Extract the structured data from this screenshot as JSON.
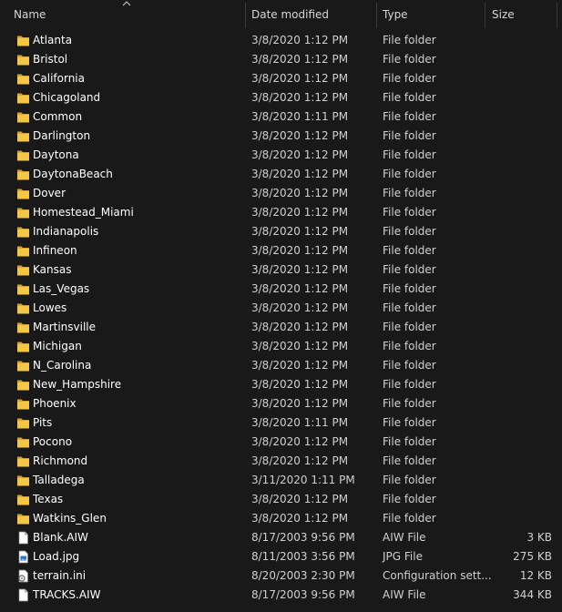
{
  "columns": {
    "name": "Name",
    "date": "Date modified",
    "type": "Type",
    "size": "Size"
  },
  "colors": {
    "background": "#191919",
    "folder": "#f3c645",
    "folder_dark": "#d8a52a",
    "separator": "#3a3a3a"
  },
  "files": [
    {
      "name": "Atlanta",
      "date": "3/8/2020 1:12 PM",
      "type": "File folder",
      "size": "",
      "icon": "folder-icon"
    },
    {
      "name": "Bristol",
      "date": "3/8/2020 1:12 PM",
      "type": "File folder",
      "size": "",
      "icon": "folder-icon"
    },
    {
      "name": "California",
      "date": "3/8/2020 1:12 PM",
      "type": "File folder",
      "size": "",
      "icon": "folder-icon"
    },
    {
      "name": "Chicagoland",
      "date": "3/8/2020 1:12 PM",
      "type": "File folder",
      "size": "",
      "icon": "folder-icon"
    },
    {
      "name": "Common",
      "date": "3/8/2020 1:11 PM",
      "type": "File folder",
      "size": "",
      "icon": "folder-icon"
    },
    {
      "name": "Darlington",
      "date": "3/8/2020 1:12 PM",
      "type": "File folder",
      "size": "",
      "icon": "folder-icon"
    },
    {
      "name": "Daytona",
      "date": "3/8/2020 1:12 PM",
      "type": "File folder",
      "size": "",
      "icon": "folder-icon"
    },
    {
      "name": "DaytonaBeach",
      "date": "3/8/2020 1:12 PM",
      "type": "File folder",
      "size": "",
      "icon": "folder-icon"
    },
    {
      "name": "Dover",
      "date": "3/8/2020 1:12 PM",
      "type": "File folder",
      "size": "",
      "icon": "folder-icon"
    },
    {
      "name": "Homestead_Miami",
      "date": "3/8/2020 1:12 PM",
      "type": "File folder",
      "size": "",
      "icon": "folder-icon"
    },
    {
      "name": "Indianapolis",
      "date": "3/8/2020 1:12 PM",
      "type": "File folder",
      "size": "",
      "icon": "folder-icon"
    },
    {
      "name": "Infineon",
      "date": "3/8/2020 1:12 PM",
      "type": "File folder",
      "size": "",
      "icon": "folder-icon"
    },
    {
      "name": "Kansas",
      "date": "3/8/2020 1:12 PM",
      "type": "File folder",
      "size": "",
      "icon": "folder-icon"
    },
    {
      "name": "Las_Vegas",
      "date": "3/8/2020 1:12 PM",
      "type": "File folder",
      "size": "",
      "icon": "folder-icon"
    },
    {
      "name": "Lowes",
      "date": "3/8/2020 1:12 PM",
      "type": "File folder",
      "size": "",
      "icon": "folder-icon"
    },
    {
      "name": "Martinsville",
      "date": "3/8/2020 1:12 PM",
      "type": "File folder",
      "size": "",
      "icon": "folder-icon"
    },
    {
      "name": "Michigan",
      "date": "3/8/2020 1:12 PM",
      "type": "File folder",
      "size": "",
      "icon": "folder-icon"
    },
    {
      "name": "N_Carolina",
      "date": "3/8/2020 1:12 PM",
      "type": "File folder",
      "size": "",
      "icon": "folder-icon"
    },
    {
      "name": "New_Hampshire",
      "date": "3/8/2020 1:12 PM",
      "type": "File folder",
      "size": "",
      "icon": "folder-icon"
    },
    {
      "name": "Phoenix",
      "date": "3/8/2020 1:12 PM",
      "type": "File folder",
      "size": "",
      "icon": "folder-icon"
    },
    {
      "name": "Pits",
      "date": "3/8/2020 1:11 PM",
      "type": "File folder",
      "size": "",
      "icon": "folder-icon"
    },
    {
      "name": "Pocono",
      "date": "3/8/2020 1:12 PM",
      "type": "File folder",
      "size": "",
      "icon": "folder-icon"
    },
    {
      "name": "Richmond",
      "date": "3/8/2020 1:12 PM",
      "type": "File folder",
      "size": "",
      "icon": "folder-icon"
    },
    {
      "name": "Talladega",
      "date": "3/11/2020 1:11 PM",
      "type": "File folder",
      "size": "",
      "icon": "folder-icon"
    },
    {
      "name": "Texas",
      "date": "3/8/2020 1:12 PM",
      "type": "File folder",
      "size": "",
      "icon": "folder-icon"
    },
    {
      "name": "Watkins_Glen",
      "date": "3/8/2020 1:12 PM",
      "type": "File folder",
      "size": "",
      "icon": "folder-icon"
    },
    {
      "name": "Blank.AIW",
      "date": "8/17/2003 9:56 PM",
      "type": "AIW File",
      "size": "3 KB",
      "icon": "file-icon"
    },
    {
      "name": "Load.jpg",
      "date": "8/11/2003 3:56 PM",
      "type": "JPG File",
      "size": "275 KB",
      "icon": "image-file-icon"
    },
    {
      "name": "terrain.ini",
      "date": "8/20/2003 2:30 PM",
      "type": "Configuration sett...",
      "size": "12 KB",
      "icon": "settings-file-icon"
    },
    {
      "name": "TRACKS.AIW",
      "date": "8/17/2003 9:56 PM",
      "type": "AIW File",
      "size": "344 KB",
      "icon": "file-icon"
    }
  ]
}
